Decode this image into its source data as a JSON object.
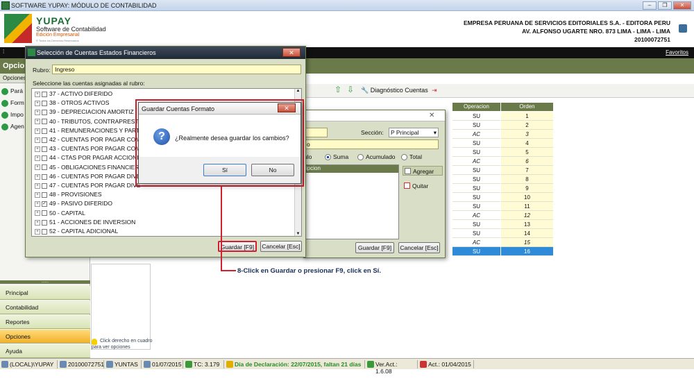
{
  "window": {
    "title": "SOFTWARE YUPAY: MÓDULO DE CONTABILIDAD"
  },
  "brand": {
    "name": "YUPAY",
    "line1": "Software de Contabilidad",
    "line2": "Edición Empresarial",
    "line3": "© Todos los Derechos Reservados"
  },
  "company": {
    "name": "EMPRESA PERUANA DE SERVICIOS EDITORIALES S.A. - EDITORA PERU",
    "address": "AV. ALFONSO UGARTE NRO. 873 LIMA - LIMA - LIMA",
    "ruc": "20100072751"
  },
  "favorites": "Favoritos",
  "left_panel": {
    "title": "Opcio",
    "sub": "Opciones",
    "items": [
      "Pará",
      "Form",
      "Impo",
      "Agen"
    ],
    "handle": "......",
    "nav": [
      "Principal",
      "Contabilidad",
      "Reportes",
      "Opciones",
      "Ayuda"
    ],
    "tip": "Click derecho en cuadro para ver opciones"
  },
  "toolbar": {
    "diag": "Diagnóstico Cuentas"
  },
  "table": {
    "headers": [
      "Operacion",
      "Orden"
    ],
    "rows": [
      {
        "op": "SU",
        "ord": "1"
      },
      {
        "op": "SU",
        "ord": "2"
      },
      {
        "op": "AC",
        "ord": "3"
      },
      {
        "op": "SU",
        "ord": "4"
      },
      {
        "op": "SU",
        "ord": "5"
      },
      {
        "op": "AC",
        "ord": "6"
      },
      {
        "op": "SU",
        "ord": "7"
      },
      {
        "op": "SU",
        "ord": "8"
      },
      {
        "op": "SU",
        "ord": "9"
      },
      {
        "op": "SU",
        "ord": "10"
      },
      {
        "op": "SU",
        "ord": "11"
      },
      {
        "op": "AC",
        "ord": "12"
      },
      {
        "op": "SU",
        "ord": "13"
      },
      {
        "op": "SU",
        "ord": "14"
      },
      {
        "op": "AC",
        "ord": "15"
      },
      {
        "op": "SU",
        "ord": "16"
      }
    ]
  },
  "mid_dialog": {
    "seccion_label": "Sección:",
    "seccion_value": "P   Principal",
    "field2": "o",
    "radio1": "ulo",
    "radio2": "Suma",
    "radio3": "Acumulado",
    "radio4": "Total",
    "list_header": "ipcion",
    "agregar": "Agregar",
    "quitar": "Quitar",
    "guardar": "Guardar [F9]",
    "cancelar": "Cancelar [Esc]"
  },
  "main_dialog": {
    "title": "Selección de Cuentas Estados Financieros",
    "rubro_label": "Rubro:",
    "rubro_value": "Ingreso",
    "list_label": "Seleccione las cuentas asignadas al rubro:",
    "nodes": [
      {
        "label": "37 - ACTIVO DIFERIDO",
        "checked": false
      },
      {
        "label": "38 - OTROS ACTIVOS",
        "checked": false
      },
      {
        "label": "39 - DEPRECIACION AMORTIZ",
        "checked": false
      },
      {
        "label": "40 - TRIBUTOS, CONTRAPRESTA",
        "checked": false
      },
      {
        "label": "41 - REMUNERACIONES Y PART",
        "checked": false
      },
      {
        "label": "42 - CUENTAS POR PAGAR COM",
        "checked": false
      },
      {
        "label": "43 - CUENTAS POR PAGAR COM",
        "checked": false
      },
      {
        "label": "44 - CTAS POR PAGAR ACCIONI",
        "checked": false
      },
      {
        "label": "45 - OBLIGACIONES FINANCIERA",
        "checked": false
      },
      {
        "label": "46 - CUENTAS POR PAGAR DIVE",
        "checked": false
      },
      {
        "label": "47 - CUENTAS POR PAGAR DIVE",
        "checked": false
      },
      {
        "label": "48 - PROVISIONES",
        "checked": false
      },
      {
        "label": "49 - PASIVO DIFERIDO",
        "checked": true
      },
      {
        "label": "50 - CAPITAL",
        "checked": false
      },
      {
        "label": "51 - ACCIONES DE INVERSION",
        "checked": false
      },
      {
        "label": "52 - CAPITAL ADICIONAL",
        "checked": false
      }
    ],
    "guardar": "Guardar [F9]",
    "cancelar": "Cancelar [Esc]"
  },
  "confirm": {
    "title": "Guardar Cuentas Formato",
    "message": "¿Realmente desea guardar los cambios?",
    "yes": "Sí",
    "no": "No"
  },
  "annotation": "8-Click en Guardar o presionar F9, click en Sí.",
  "status": {
    "db": "(LOCAL)\\YUPAY",
    "ruc": "20100072751",
    "user": "YUNTAS",
    "date": "01/07/2015",
    "tc": "TC: 3.179",
    "decl": "Día de Declaración: 22/07/2015, faltan 21 días",
    "ver": "Ver.Act.: 1.6.08",
    "act": "Act.: 01/04/2015"
  },
  "colors": {
    "accent": "#6a7a4a",
    "highlight": "#d02030",
    "selected": "#2f8bd8"
  }
}
